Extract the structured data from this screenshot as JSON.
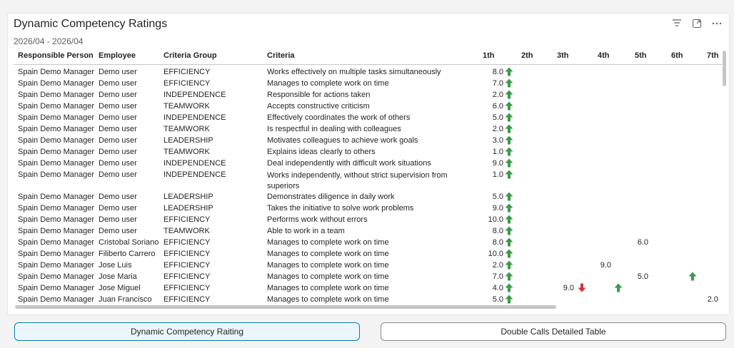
{
  "visual": {
    "title": "Dynamic Competency Ratings",
    "subtitle": "2026/04 - 2026/04",
    "icons": [
      "filter-icon",
      "focus-mode-icon",
      "more-options-icon"
    ]
  },
  "colors": {
    "up": "#3a9a4a",
    "down": "#d13438",
    "active_button_border": "#0c7c9e"
  },
  "table": {
    "columns": [
      "Responsible Person",
      "Employee",
      "Criteria Group",
      "Criteria",
      "1th",
      "2th",
      "3th",
      "4th",
      "5th",
      "6th",
      "7th"
    ],
    "rows": [
      {
        "person": "Spain Demo Manager",
        "employee": "Demo user",
        "group": "EFFICIENCY",
        "criteria": "Works effectively on multiple tasks simultaneously",
        "v1": "8.0",
        "a1": "up"
      },
      {
        "person": "Spain Demo Manager",
        "employee": "Demo user",
        "group": "EFFICIENCY",
        "criteria": "Manages to complete work on time",
        "v1": "7.0",
        "a1": "up"
      },
      {
        "person": "Spain Demo Manager",
        "employee": "Demo user",
        "group": "INDEPENDENCE",
        "criteria": "Responsible for actions taken",
        "v1": "2.0",
        "a1": "up"
      },
      {
        "person": "Spain Demo Manager",
        "employee": "Demo user",
        "group": "TEAMWORK",
        "criteria": "Accepts constructive criticism",
        "v1": "6.0",
        "a1": "up"
      },
      {
        "person": "Spain Demo Manager",
        "employee": "Demo user",
        "group": "INDEPENDENCE",
        "criteria": "Effectively coordinates the work of others",
        "v1": "5.0",
        "a1": "up"
      },
      {
        "person": "Spain Demo Manager",
        "employee": "Demo user",
        "group": "TEAMWORK",
        "criteria": "Is respectful in dealing with colleagues",
        "v1": "2.0",
        "a1": "up"
      },
      {
        "person": "Spain Demo Manager",
        "employee": "Demo user",
        "group": "LEADERSHIP",
        "criteria": "Motivates colleagues to achieve work goals",
        "v1": "3.0",
        "a1": "up"
      },
      {
        "person": "Spain Demo Manager",
        "employee": "Demo user",
        "group": "TEAMWORK",
        "criteria": "Explains ideas clearly to others",
        "v1": "1.0",
        "a1": "up"
      },
      {
        "person": "Spain Demo Manager",
        "employee": "Demo user",
        "group": "INDEPENDENCE",
        "criteria": "Deal independently with difficult work situations",
        "v1": "9.0",
        "a1": "up"
      },
      {
        "person": "Spain Demo Manager",
        "employee": "Demo user",
        "group": "INDEPENDENCE",
        "criteria": "Works independently, without strict supervision from superiors",
        "v1": "1.0",
        "a1": "up",
        "tall": true
      },
      {
        "person": "Spain Demo Manager",
        "employee": "Demo user",
        "group": "LEADERSHIP",
        "criteria": "Demonstrates diligence in daily work",
        "v1": "5.0",
        "a1": "up"
      },
      {
        "person": "Spain Demo Manager",
        "employee": "Demo user",
        "group": "LEADERSHIP",
        "criteria": "Takes the initiative to solve work problems",
        "v1": "9.0",
        "a1": "up"
      },
      {
        "person": "Spain Demo Manager",
        "employee": "Demo user",
        "group": "EFFICIENCY",
        "criteria": "Performs work without errors",
        "v1": "10.0",
        "a1": "up"
      },
      {
        "person": "Spain Demo Manager",
        "employee": "Demo user",
        "group": "TEAMWORK",
        "criteria": "Able to work in a team",
        "v1": "8.0",
        "a1": "up"
      },
      {
        "person": "Spain Demo Manager",
        "employee": "Cristobal Soriano",
        "group": "EFFICIENCY",
        "criteria": "Manages to complete work on time",
        "v1": "8.0",
        "a1": "up",
        "v5": "6.0"
      },
      {
        "person": "Spain Demo Manager",
        "employee": "Filiberto Carrero",
        "group": "EFFICIENCY",
        "criteria": "Manages to complete work on time",
        "v1": "10.0",
        "a1": "up"
      },
      {
        "person": "Spain Demo Manager",
        "employee": "Jose Luis",
        "group": "EFFICIENCY",
        "criteria": "Manages to complete work on time",
        "v1": "2.0",
        "a1": "up",
        "v4": "9.0"
      },
      {
        "person": "Spain Demo Manager",
        "employee": "Jose Maria",
        "group": "EFFICIENCY",
        "criteria": "Manages to complete work on time",
        "v1": "7.0",
        "a1": "up",
        "v5": "5.0",
        "a6": "up"
      },
      {
        "person": "Spain Demo Manager",
        "employee": "Jose Miguel",
        "group": "EFFICIENCY",
        "criteria": "Manages to complete work on time",
        "v1": "4.0",
        "a1": "up",
        "v3": "9.0",
        "a3": "down",
        "a4": "up"
      },
      {
        "person": "Spain Demo Manager",
        "employee": "Juan Francisco",
        "group": "EFFICIENCY",
        "criteria": "Manages to complete work on time",
        "v1": "5.0",
        "a1": "up",
        "v7": "2.0"
      }
    ]
  },
  "buttons": {
    "dynamic": "Dynamic Competency Raiting",
    "double_calls": "Double Calls Detailed Table"
  }
}
